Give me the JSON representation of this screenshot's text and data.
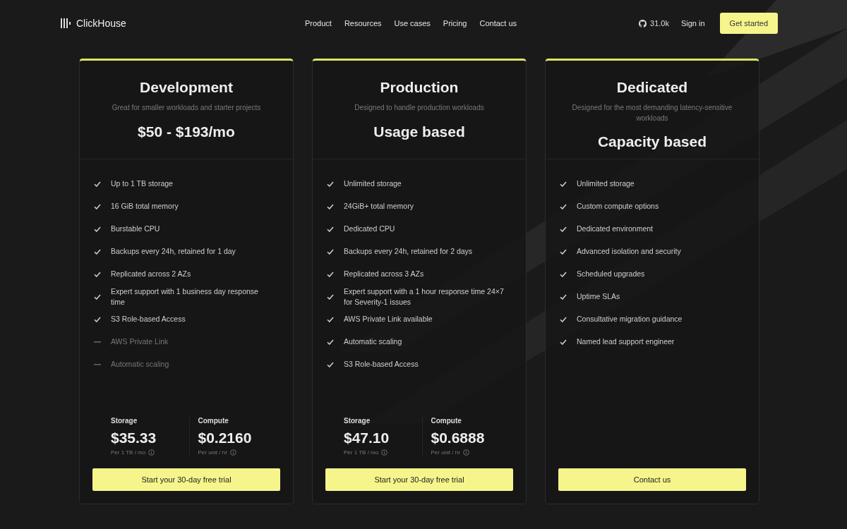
{
  "nav": {
    "logo": "ClickHouse",
    "links": [
      "Product",
      "Resources",
      "Use cases",
      "Pricing",
      "Contact us"
    ],
    "stars": "31.0k",
    "sign_in": "Sign in",
    "cta": "Get started"
  },
  "plans": [
    {
      "name": "Development",
      "subtitle": "Great for smaller workloads and starter projects",
      "price": "$50 - $193/mo",
      "features": [
        {
          "text": "Up to 1 TB storage",
          "included": true
        },
        {
          "text": "16 GiB total memory",
          "included": true
        },
        {
          "text": "Burstable CPU",
          "included": true
        },
        {
          "text": "Backups every 24h, retained for 1 day",
          "included": true
        },
        {
          "text": "Replicated across 2 AZs",
          "included": true
        },
        {
          "text": "Expert support with 1 business day response time",
          "included": true
        },
        {
          "text": "S3 Role-based Access",
          "included": true
        },
        {
          "text": "AWS Private Link",
          "included": false
        },
        {
          "text": "Automatic scaling",
          "included": false
        }
      ],
      "rates": [
        {
          "label": "Storage",
          "value": "$35.33",
          "unit": "Per 1 TB / mo"
        },
        {
          "label": "Compute",
          "value": "$0.2160",
          "unit": "Per unit / hr"
        }
      ],
      "button": "Start your 30-day free trial"
    },
    {
      "name": "Production",
      "subtitle": "Designed to handle production workloads",
      "price": "Usage based",
      "features": [
        {
          "text": "Unlimited storage",
          "included": true
        },
        {
          "text": "24GiB+ total memory",
          "included": true
        },
        {
          "text": "Dedicated CPU",
          "included": true
        },
        {
          "text": "Backups every 24h, retained for 2 days",
          "included": true
        },
        {
          "text": "Replicated across 3 AZs",
          "included": true
        },
        {
          "text": "Expert support with a 1 hour response time 24×7 for Severity-1 issues",
          "included": true
        },
        {
          "text": "AWS Private Link available",
          "included": true
        },
        {
          "text": "Automatic scaling",
          "included": true
        },
        {
          "text": "S3 Role-based Access",
          "included": true
        }
      ],
      "rates": [
        {
          "label": "Storage",
          "value": "$47.10",
          "unit": "Per 1 TB / mo"
        },
        {
          "label": "Compute",
          "value": "$0.6888",
          "unit": "Per unit / hr"
        }
      ],
      "button": "Start your 30-day free trial"
    },
    {
      "name": "Dedicated",
      "subtitle": "Designed for the most demanding latency-sensitive workloads",
      "price": "Capacity based",
      "features": [
        {
          "text": "Unlimited storage",
          "included": true
        },
        {
          "text": "Custom compute options",
          "included": true
        },
        {
          "text": "Dedicated environment",
          "included": true
        },
        {
          "text": "Advanced isolation and security",
          "included": true
        },
        {
          "text": "Scheduled upgrades",
          "included": true
        },
        {
          "text": "Uptime SLAs",
          "included": true
        },
        {
          "text": "Consultative migration guidance",
          "included": true
        },
        {
          "text": "Named lead support engineer",
          "included": true
        }
      ],
      "button": "Contact us"
    }
  ]
}
